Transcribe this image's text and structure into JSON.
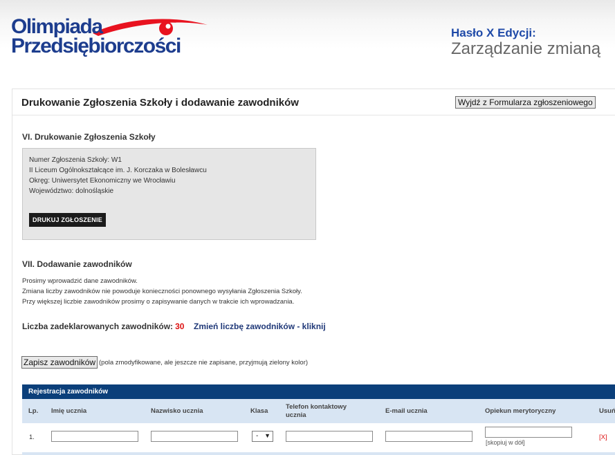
{
  "brand": {
    "logo_line1": "Olimpiada",
    "logo_line2": "Przedsiębiorczości",
    "edition_label": "Hasło X Edycji:",
    "edition_motto": "Zarządzanie zmianą",
    "accent_red": "#e8121f",
    "accent_blue": "#1d3d8e"
  },
  "page": {
    "title": "Drukowanie Zgłoszenia Szkoły i dodawanie zawodników",
    "exit_button": "Wyjdź z Formularza zgłoszeniowego"
  },
  "section6": {
    "heading": "VI. Drukowanie Zgłoszenia Szkoły",
    "lines": [
      "Numer Zgłoszenia Szkoły: W1",
      "II Liceum Ogólnokształcące im. J. Korczaka w Bolesławcu",
      "Okręg: Uniwersytet Ekonomiczny we Wrocławiu",
      "Województwo: dolnośląskie"
    ],
    "print_button": "DRUKUJ ZGŁOSZENIE"
  },
  "section7": {
    "heading": "VII. Dodawanie zawodników",
    "paragraphs": [
      "Prosimy wprowadzić dane zawodników.",
      "Zmiana liczby zawodników nie powoduje konieczności ponownego wysyłania Zgłoszenia Szkoły.",
      "Przy większej liczbie zawodników prosimy o zapisywanie danych w trakcie ich wprowadzania."
    ],
    "declared_label": "Liczba zadeklarowanych zawodników:",
    "declared_count": "30",
    "change_link": "Zmień liczbę zawodników - kliknij",
    "save_button": "Zapisz zawodników",
    "save_note": "(pola zmodyfikowane, ale jeszcze nie zapisane, przyjmują zielony kolor)"
  },
  "table": {
    "title": "Rejestracja zawodników",
    "columns": {
      "lp": "Lp.",
      "first_name": "Imię ucznia",
      "last_name": "Nazwisko ucznia",
      "class": "Klasa",
      "phone": "Telefon kontaktowy ucznia",
      "email": "E-mail ucznia",
      "tutor": "Opiekun merytoryczny",
      "remove": "Usuń"
    },
    "rows": [
      {
        "lp": "1.",
        "first_name": "",
        "last_name": "",
        "class": "-",
        "phone": "",
        "email": "",
        "tutor": "",
        "copy_hint": "[skopiuj w dół]",
        "remove": "[X]"
      }
    ]
  }
}
